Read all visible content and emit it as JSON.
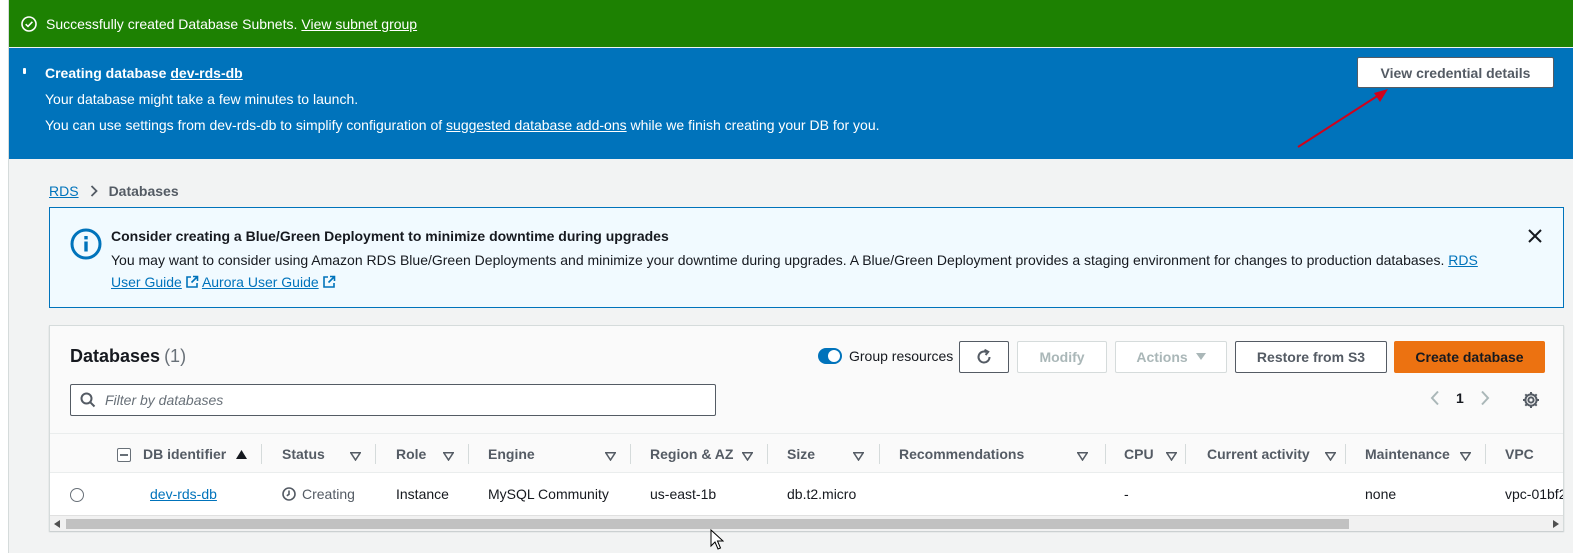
{
  "success_flash": {
    "message": "Successfully created Database Subnets.",
    "link": "View subnet group"
  },
  "creating_flash": {
    "title_prefix": "Creating database",
    "db_link": "dev-rds-db",
    "line2": "Your database might take a few minutes to launch.",
    "line3_prefix": "You can use settings from dev-rds-db to simplify configuration of",
    "line3_link": "suggested database add-ons",
    "line3_suffix": "while we finish creating your DB for you.",
    "button": "View credential details"
  },
  "breadcrumb": {
    "root": "RDS",
    "current": "Databases"
  },
  "bluegreen_alert": {
    "title": "Consider creating a Blue/Green Deployment to minimize downtime during upgrades",
    "body": "You may want to consider using Amazon RDS Blue/Green Deployments and minimize your downtime during upgrades. A Blue/Green Deployment provides a staging environment for changes to production databases.",
    "link1": "RDS User Guide",
    "link2": "Aurora User Guide"
  },
  "panel": {
    "title": "Databases",
    "count": "(1)",
    "group_resources": "Group resources",
    "modify": "Modify",
    "actions": "Actions",
    "restore": "Restore from S3",
    "create": "Create database",
    "search_placeholder": "Filter by databases",
    "page": "1"
  },
  "table": {
    "columns": [
      "DB identifier",
      "Status",
      "Role",
      "Engine",
      "Region & AZ",
      "Size",
      "Recommendations",
      "CPU",
      "Current activity",
      "Maintenance",
      "VPC"
    ],
    "rows": [
      {
        "identifier": "dev-rds-db",
        "status": "Creating",
        "role": "Instance",
        "engine": "MySQL Community",
        "region": "us-east-1b",
        "size": "db.t2.micro",
        "recommendations": "",
        "cpu": "-",
        "activity": "",
        "maintenance": "none",
        "vpc": "vpc-01bf2"
      }
    ]
  },
  "colors": {
    "success": "#1d8102",
    "info": "#0073bb",
    "primary": "#ec7211",
    "link": "#0073bb"
  }
}
